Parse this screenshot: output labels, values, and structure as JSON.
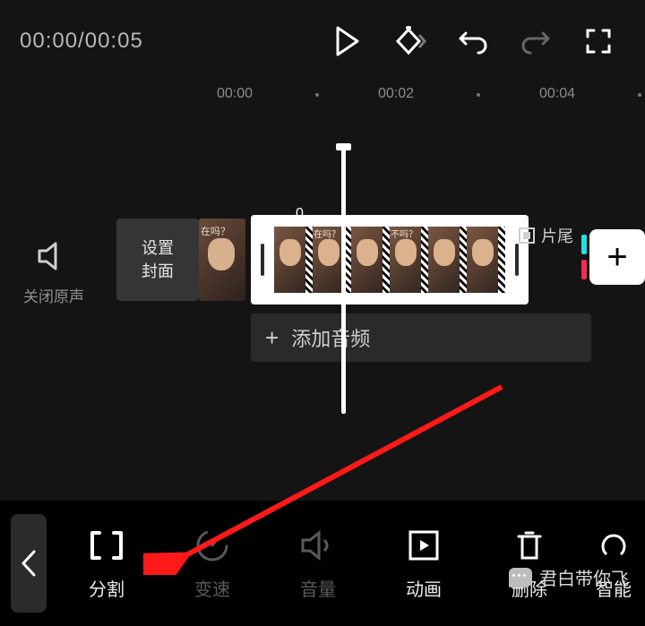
{
  "top": {
    "timecode": "00:00/00:05"
  },
  "ruler": [
    "00:00",
    "00:02",
    "00:04"
  ],
  "timeline": {
    "mute_label": "关闭原声",
    "cover_l1": "设置",
    "cover_l2": "封面",
    "ask": "在吗？",
    "ask2": "不吗？",
    "select_start": "0",
    "ending": "片尾",
    "add_audio": "添加音频"
  },
  "tools": [
    {
      "id": "split",
      "label": "分割"
    },
    {
      "id": "speed",
      "label": "变速"
    },
    {
      "id": "volume",
      "label": "音量"
    },
    {
      "id": "animation",
      "label": "动画"
    },
    {
      "id": "delete",
      "label": "删除"
    },
    {
      "id": "smart",
      "label": "智能"
    }
  ],
  "watermark": "君白带你飞"
}
